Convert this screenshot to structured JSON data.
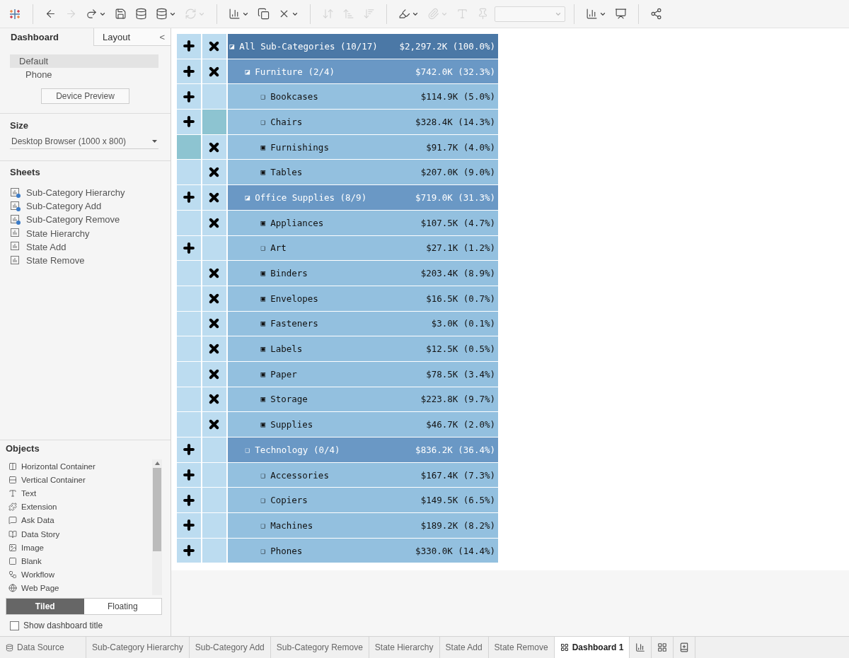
{
  "toolbar": [
    {
      "kind": "logo",
      "disabled": false,
      "dropdown": false
    },
    {
      "kind": "separator"
    },
    {
      "kind": "back",
      "disabled": false,
      "dropdown": false
    },
    {
      "kind": "forward",
      "disabled": true,
      "dropdown": false
    },
    {
      "kind": "redo",
      "disabled": false,
      "dropdown": true
    },
    {
      "kind": "save",
      "disabled": false,
      "dropdown": false
    },
    {
      "kind": "new-data-source",
      "disabled": false,
      "dropdown": false
    },
    {
      "kind": "pause-data",
      "disabled": false,
      "dropdown": true
    },
    {
      "kind": "refresh",
      "disabled": true,
      "dropdown": true
    },
    {
      "kind": "separator"
    },
    {
      "kind": "new-sheet",
      "disabled": false,
      "dropdown": true
    },
    {
      "kind": "duplicate",
      "disabled": false,
      "dropdown": false
    },
    {
      "kind": "clear",
      "disabled": false,
      "dropdown": true
    },
    {
      "kind": "separator"
    },
    {
      "kind": "swap",
      "disabled": true,
      "dropdown": false
    },
    {
      "kind": "sort-ascending",
      "disabled": true,
      "dropdown": false
    },
    {
      "kind": "sort-descending",
      "disabled": true,
      "dropdown": false
    },
    {
      "kind": "separator"
    },
    {
      "kind": "highlight",
      "disabled": false,
      "dropdown": true
    },
    {
      "kind": "attach",
      "disabled": true,
      "dropdown": true
    },
    {
      "kind": "label",
      "disabled": true,
      "dropdown": false
    },
    {
      "kind": "pin",
      "disabled": true,
      "dropdown": false
    },
    {
      "kind": "fit-select",
      "disabled": true,
      "dropdown": true
    },
    {
      "kind": "separator"
    },
    {
      "kind": "show-me",
      "disabled": false,
      "dropdown": true
    },
    {
      "kind": "presentation",
      "disabled": false,
      "dropdown": false
    },
    {
      "kind": "separator"
    },
    {
      "kind": "share",
      "disabled": false,
      "dropdown": false
    }
  ],
  "side_tabs": [
    {
      "label": "Dashboard",
      "selected": true
    },
    {
      "label": "Layout",
      "selected": false
    }
  ],
  "collapse_glyph": "<",
  "devices": [
    {
      "label": "Default",
      "selected": true
    },
    {
      "label": "Phone",
      "selected": false
    }
  ],
  "device_preview_button": "Device Preview",
  "size": {
    "heading": "Size",
    "value": "Desktop Browser (1000 x 800)"
  },
  "sheets": {
    "heading": "Sheets",
    "items": [
      {
        "label": "Sub-Category Hierarchy",
        "in_use": true
      },
      {
        "label": "Sub-Category Add",
        "in_use": true
      },
      {
        "label": "Sub-Category Remove",
        "in_use": true
      },
      {
        "label": "State Hierarchy",
        "in_use": false
      },
      {
        "label": "State Add",
        "in_use": false
      },
      {
        "label": "State Remove",
        "in_use": false
      }
    ]
  },
  "objects": {
    "heading": "Objects",
    "items": [
      {
        "label": "Horizontal Container",
        "kind": "horizontal"
      },
      {
        "label": "Vertical Container",
        "kind": "vertical"
      },
      {
        "label": "Text",
        "kind": "text"
      },
      {
        "label": "Extension",
        "kind": "extension"
      },
      {
        "label": "Ask Data",
        "kind": "ask"
      },
      {
        "label": "Data Story",
        "kind": "story"
      },
      {
        "label": "Image",
        "kind": "image"
      },
      {
        "label": "Blank",
        "kind": "blank"
      },
      {
        "label": "Workflow",
        "kind": "workflow"
      },
      {
        "label": "Web Page",
        "kind": "web"
      }
    ]
  },
  "layout_mode": [
    {
      "label": "Tiled",
      "selected": true
    },
    {
      "label": "Floating",
      "selected": false
    }
  ],
  "show_title": {
    "label": "Show dashboard title",
    "checked": false
  },
  "rows": [
    {
      "label": "All Sub-Categories (10/17)",
      "value": "$2,297.2K (100.0%)",
      "box": "◪",
      "add": true,
      "remove": true,
      "add_highlighted": false,
      "remove_highlighted": false,
      "children": [
        {
          "label": "Furniture (2/4)",
          "value": "$742.0K (32.3%)",
          "box": "◪",
          "add": true,
          "remove": true,
          "add_highlighted": false,
          "remove_highlighted": false,
          "children": [
            {
              "label": "Bookcases",
              "value": "$114.9K (5.0%)",
              "box": "❑",
              "add": true,
              "remove": false,
              "add_highlighted": false,
              "remove_highlighted": false
            },
            {
              "label": "Chairs",
              "value": "$328.4K (14.3%)",
              "box": "❑",
              "add": true,
              "remove": false,
              "add_highlighted": false,
              "remove_highlighted": true
            },
            {
              "label": "Furnishings",
              "value": "$91.7K (4.0%)",
              "box": "▣",
              "add": false,
              "remove": true,
              "add_highlighted": true,
              "remove_highlighted": false
            },
            {
              "label": "Tables",
              "value": "$207.0K (9.0%)",
              "box": "▣",
              "add": false,
              "remove": true,
              "add_highlighted": false,
              "remove_highlighted": false
            }
          ]
        },
        {
          "label": "Office Supplies (8/9)",
          "value": "$719.0K (31.3%)",
          "box": "◪",
          "add": true,
          "remove": true,
          "add_highlighted": false,
          "remove_highlighted": false,
          "children": [
            {
              "label": "Appliances",
              "value": "$107.5K (4.7%)",
              "box": "▣",
              "add": false,
              "remove": true,
              "add_highlighted": false,
              "remove_highlighted": false
            },
            {
              "label": "Art",
              "value": "$27.1K (1.2%)",
              "box": "❑",
              "add": true,
              "remove": false,
              "add_highlighted": false,
              "remove_highlighted": false
            },
            {
              "label": "Binders",
              "value": "$203.4K (8.9%)",
              "box": "▣",
              "add": false,
              "remove": true,
              "add_highlighted": false,
              "remove_highlighted": false
            },
            {
              "label": "Envelopes",
              "value": "$16.5K (0.7%)",
              "box": "▣",
              "add": false,
              "remove": true,
              "add_highlighted": false,
              "remove_highlighted": false
            },
            {
              "label": "Fasteners",
              "value": "$3.0K (0.1%)",
              "box": "▣",
              "add": false,
              "remove": true,
              "add_highlighted": false,
              "remove_highlighted": false
            },
            {
              "label": "Labels",
              "value": "$12.5K (0.5%)",
              "box": "▣",
              "add": false,
              "remove": true,
              "add_highlighted": false,
              "remove_highlighted": false
            },
            {
              "label": "Paper",
              "value": "$78.5K (3.4%)",
              "box": "▣",
              "add": false,
              "remove": true,
              "add_highlighted": false,
              "remove_highlighted": false
            },
            {
              "label": "Storage",
              "value": "$223.8K (9.7%)",
              "box": "▣",
              "add": false,
              "remove": true,
              "add_highlighted": false,
              "remove_highlighted": false
            },
            {
              "label": "Supplies",
              "value": "$46.7K (2.0%)",
              "box": "▣",
              "add": false,
              "remove": true,
              "add_highlighted": false,
              "remove_highlighted": false
            }
          ]
        },
        {
          "label": "Technology (0/4)",
          "value": "$836.2K (36.4%)",
          "box": "❑",
          "add": true,
          "remove": false,
          "add_highlighted": false,
          "remove_highlighted": false,
          "children": [
            {
              "label": "Accessories",
              "value": "$167.4K (7.3%)",
              "box": "❑",
              "add": true,
              "remove": false,
              "add_highlighted": false,
              "remove_highlighted": false
            },
            {
              "label": "Copiers",
              "value": "$149.5K (6.5%)",
              "box": "❑",
              "add": true,
              "remove": false,
              "add_highlighted": false,
              "remove_highlighted": false
            },
            {
              "label": "Machines",
              "value": "$189.2K (8.2%)",
              "box": "❑",
              "add": true,
              "remove": false,
              "add_highlighted": false,
              "remove_highlighted": false
            },
            {
              "label": "Phones",
              "value": "$330.0K (14.4%)",
              "box": "❑",
              "add": true,
              "remove": false,
              "add_highlighted": false,
              "remove_highlighted": false
            }
          ]
        }
      ]
    }
  ],
  "bottom_tabs": [
    {
      "label": "Data Source",
      "kind": "data-source",
      "selected": false
    },
    {
      "label": "Sub-Category Hierarchy",
      "kind": "sheet",
      "selected": false
    },
    {
      "label": "Sub-Category Add",
      "kind": "sheet",
      "selected": false
    },
    {
      "label": "Sub-Category Remove",
      "kind": "sheet",
      "selected": false
    },
    {
      "label": "State Hierarchy",
      "kind": "sheet",
      "selected": false
    },
    {
      "label": "State Add",
      "kind": "sheet",
      "selected": false
    },
    {
      "label": "State Remove",
      "kind": "sheet",
      "selected": false
    },
    {
      "label": "Dashboard 1",
      "kind": "dashboard",
      "selected": true
    }
  ],
  "new_tab_buttons": [
    {
      "kind": "new-worksheet"
    },
    {
      "kind": "new-dashboard"
    },
    {
      "kind": "new-story"
    }
  ]
}
